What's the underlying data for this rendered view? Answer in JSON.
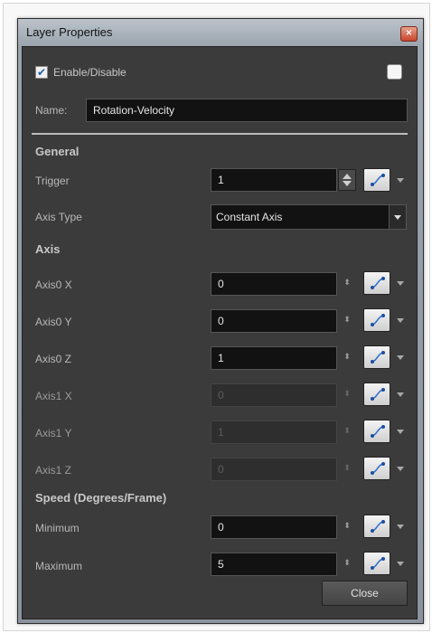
{
  "window": {
    "title": "Layer Properties",
    "close_glyph": "×"
  },
  "enable": {
    "label": "Enable/Disable",
    "checked": true
  },
  "name": {
    "label": "Name:",
    "value": "Rotation-Velocity"
  },
  "general": {
    "header": "General",
    "trigger": {
      "label": "Trigger",
      "value": "1"
    },
    "axis_type": {
      "label": "Axis Type",
      "value": "Constant Axis"
    }
  },
  "axis": {
    "header": "Axis",
    "rows": [
      {
        "label": "Axis0 X",
        "value": "0",
        "enabled": true
      },
      {
        "label": "Axis0 Y",
        "value": "0",
        "enabled": true
      },
      {
        "label": "Axis0 Z",
        "value": "1",
        "enabled": true
      },
      {
        "label": "Axis1 X",
        "value": "0",
        "enabled": false
      },
      {
        "label": "Axis1 Y",
        "value": "1",
        "enabled": false
      },
      {
        "label": "Axis1 Z",
        "value": "0",
        "enabled": false
      }
    ]
  },
  "speed": {
    "header": "Speed (Degrees/Frame)",
    "minimum": {
      "label": "Minimum",
      "value": "0"
    },
    "maximum": {
      "label": "Maximum",
      "value": "5"
    }
  },
  "buttons": {
    "close": "Close"
  },
  "icons": {
    "function": "function-curve-icon",
    "dropdown": "chevron-down-icon",
    "spin": "spin-arrows-icon"
  }
}
